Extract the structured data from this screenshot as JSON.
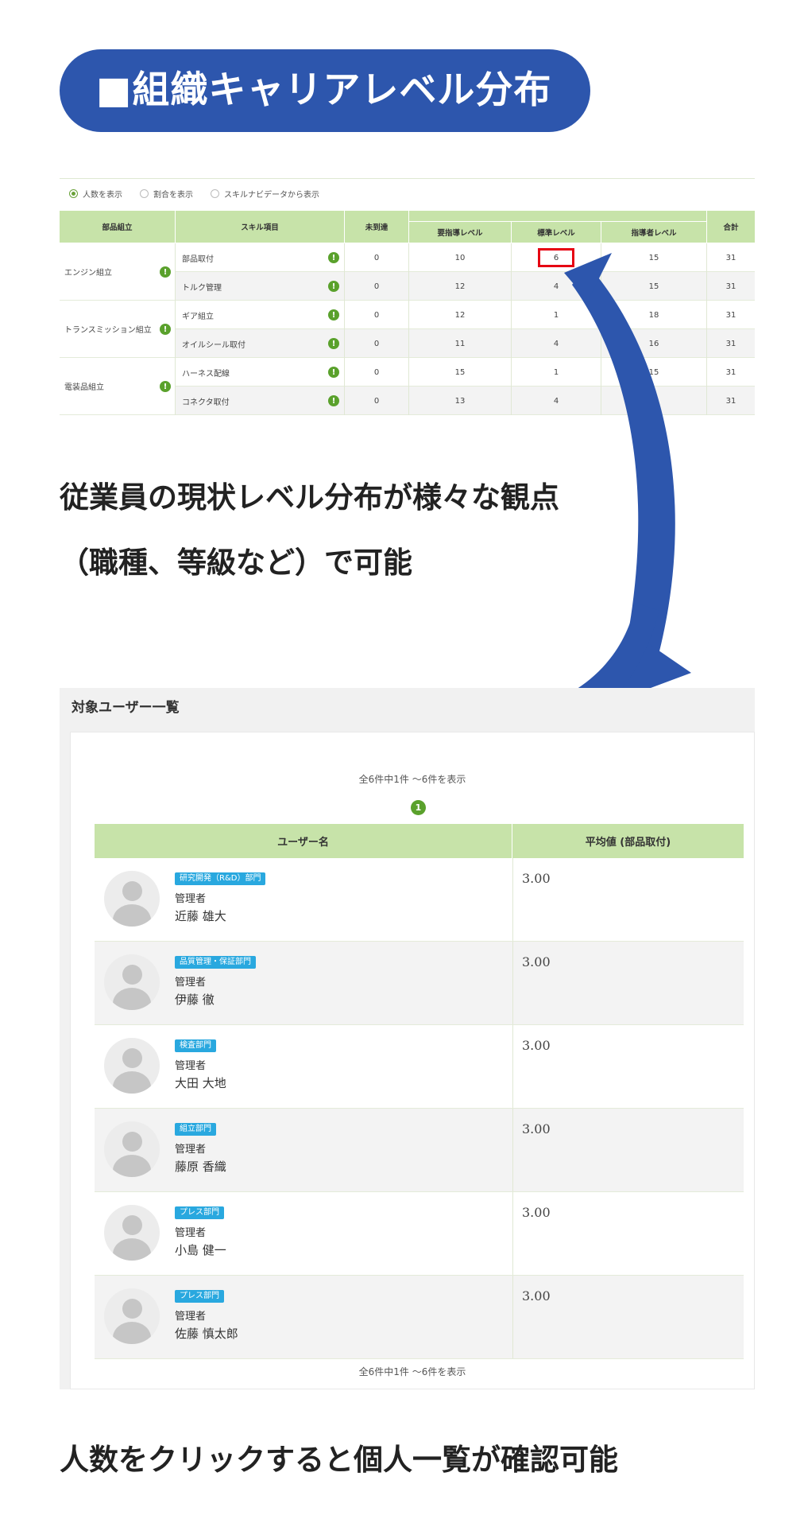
{
  "title": "■組織キャリアレベル分布",
  "radio_options": [
    {
      "label": "人数を表示",
      "selected": true
    },
    {
      "label": "割合を表示",
      "selected": false
    },
    {
      "label": "スキルナビデータから表示",
      "selected": false
    }
  ],
  "skill_table": {
    "headers": {
      "department": "部品組立",
      "skill": "スキル項目",
      "unassigned": "未到達",
      "level_needs_guidance": "要指導レベル",
      "level_standard": "標準レベル",
      "level_instructor": "指導者レベル",
      "total": "合計"
    },
    "groups": [
      {
        "name": "エンジン組立",
        "rows": [
          {
            "skill": "部品取付",
            "unassigned": "0",
            "needs": "10",
            "standard": "6",
            "instructor": "15",
            "total": "31",
            "highlight": true
          },
          {
            "skill": "トルク管理",
            "unassigned": "0",
            "needs": "12",
            "standard": "4",
            "instructor": "15",
            "total": "31"
          }
        ]
      },
      {
        "name": "トランスミッション組立",
        "rows": [
          {
            "skill": "ギア組立",
            "unassigned": "0",
            "needs": "12",
            "standard": "1",
            "instructor": "18",
            "total": "31"
          },
          {
            "skill": "オイルシール取付",
            "unassigned": "0",
            "needs": "11",
            "standard": "4",
            "instructor": "16",
            "total": "31"
          }
        ]
      },
      {
        "name": "電装品組立",
        "rows": [
          {
            "skill": "ハーネス配線",
            "unassigned": "0",
            "needs": "15",
            "standard": "1",
            "instructor": "15",
            "total": "31"
          },
          {
            "skill": "コネクタ取付",
            "unassigned": "0",
            "needs": "13",
            "standard": "4",
            "instructor": "",
            "total": "31"
          }
        ]
      }
    ],
    "warn_glyph": "!"
  },
  "description_top": [
    "従業員の現状レベル分布が様々な観点",
    "（職種、等級など）で可能"
  ],
  "user_panel": {
    "title": "対象ユーザー一覧",
    "pager_top": "全6件中1件 ～6件を表示",
    "pager_bottom": "全6件中1件 ～6件を表示",
    "current_page": "1",
    "col_user": "ユーザー名",
    "col_avg": "平均値 (部品取付)",
    "users": [
      {
        "dept": "研究開発（R&D）部門",
        "role": "管理者",
        "name": "近藤 雄大",
        "avg": "3.00"
      },
      {
        "dept": "品質管理・保証部門",
        "role": "管理者",
        "name": "伊藤 徹",
        "avg": "3.00"
      },
      {
        "dept": "検査部門",
        "role": "管理者",
        "name": "大田 大地",
        "avg": "3.00"
      },
      {
        "dept": "組立部門",
        "role": "管理者",
        "name": "藤原 香織",
        "avg": "3.00"
      },
      {
        "dept": "プレス部門",
        "role": "管理者",
        "name": "小島 健一",
        "avg": "3.00"
      },
      {
        "dept": "プレス部門",
        "role": "管理者",
        "name": "佐藤 慎太郎",
        "avg": "3.00"
      }
    ]
  },
  "description_bottom": "人数をクリックすると個人一覧が確認可能",
  "colors": {
    "pill": "#2d56ad",
    "header_green": "#c7e3a9",
    "accent_green": "#5aa12c",
    "badge_blue": "#29a8df",
    "highlight_red": "#e60012"
  }
}
